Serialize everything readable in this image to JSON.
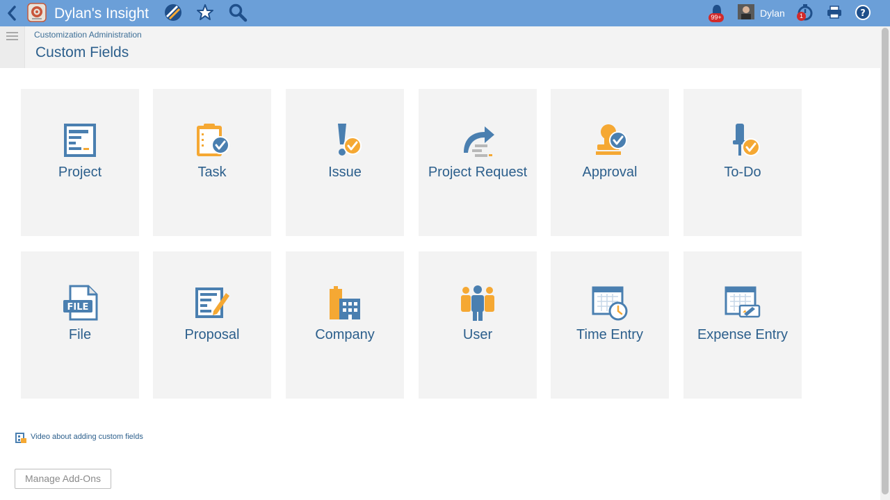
{
  "topbar": {
    "app_title": "Dylan's Insight",
    "user_name": "Dylan",
    "notifications_badge": "99+",
    "timer_badge": "1",
    "accent_color": "#6b9fd8"
  },
  "header": {
    "breadcrumb": "Customization Administration",
    "page_title": "Custom Fields"
  },
  "tiles": [
    {
      "label": "Project",
      "icon": "project-icon"
    },
    {
      "label": "Task",
      "icon": "task-icon"
    },
    {
      "label": "Issue",
      "icon": "issue-icon"
    },
    {
      "label": "Project Request",
      "icon": "project-request-icon"
    },
    {
      "label": "Approval",
      "icon": "approval-icon"
    },
    {
      "label": "To-Do",
      "icon": "todo-icon"
    },
    {
      "label": "File",
      "icon": "file-icon",
      "icon_text": "FILE"
    },
    {
      "label": "Proposal",
      "icon": "proposal-icon"
    },
    {
      "label": "Company",
      "icon": "company-icon"
    },
    {
      "label": "User",
      "icon": "user-icon"
    },
    {
      "label": "Time Entry",
      "icon": "time-entry-icon"
    },
    {
      "label": "Expense Entry",
      "icon": "expense-entry-icon"
    }
  ],
  "footer": {
    "video_link": "Video about adding custom fields",
    "manage_addons": "Manage Add-Ons"
  },
  "colors": {
    "blue_icon": "#4a7fb0",
    "orange_icon": "#f5a833",
    "title_text": "#2c5f8c"
  }
}
